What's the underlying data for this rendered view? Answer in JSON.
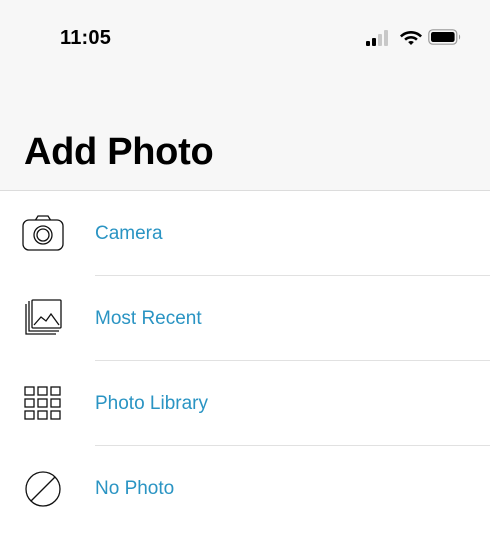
{
  "status_bar": {
    "time": "11:05",
    "signal_icon": "cellular-signal-icon",
    "wifi_icon": "wifi-icon",
    "battery_icon": "battery-icon"
  },
  "header": {
    "title": "Add Photo"
  },
  "options": [
    {
      "label": "Camera",
      "icon": "camera-icon"
    },
    {
      "label": "Most Recent",
      "icon": "photo-stack-icon"
    },
    {
      "label": "Photo Library",
      "icon": "grid-icon"
    },
    {
      "label": "No Photo",
      "icon": "prohibited-icon"
    }
  ],
  "colors": {
    "accent": "#2a94c3",
    "header_background": "#f7f7f7",
    "divider": "#e1e1e1"
  }
}
